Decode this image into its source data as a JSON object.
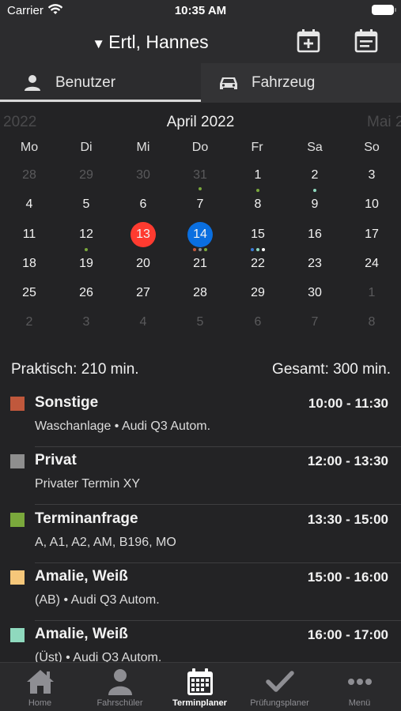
{
  "status_bar": {
    "carrier": "Carrier",
    "time": "10:35 AM"
  },
  "nav": {
    "title": "Ertl, Hannes",
    "dropdown_icon": "triangle-down-icon",
    "add_icon": "calendar-plus-icon",
    "list_icon": "calendar-list-icon"
  },
  "segment": {
    "user_label": "Benutzer",
    "vehicle_label": "Fahrzeug",
    "selected": "Benutzer"
  },
  "calendar": {
    "prev_label": "2022",
    "title": "April 2022",
    "next_label": "Mai 2",
    "weekdays": [
      "Mo",
      "Di",
      "Mi",
      "Do",
      "Fr",
      "Sa",
      "So"
    ],
    "weeks": [
      [
        "28",
        "29",
        "30",
        "31",
        "1",
        "2",
        "3"
      ],
      [
        "4",
        "5",
        "6",
        "7",
        "8",
        "9",
        "10"
      ],
      [
        "11",
        "12",
        "13",
        "14",
        "15",
        "16",
        "17"
      ],
      [
        "18",
        "19",
        "20",
        "21",
        "22",
        "23",
        "24"
      ],
      [
        "25",
        "26",
        "27",
        "28",
        "29",
        "30",
        "1"
      ],
      [
        "2",
        "3",
        "4",
        "5",
        "6",
        "7",
        "8"
      ]
    ],
    "today_color": "#ff3b30",
    "selected_color": "#0a6fe0"
  },
  "summary": {
    "practical": "Praktisch: 210 min.",
    "total": "Gesamt: 300 min."
  },
  "appointments": [
    {
      "title": "Sonstige",
      "time": "10:00 - 11:30",
      "subtitle": "Waschanlage • Audi Q3 Autom.",
      "color": "#c0583c"
    },
    {
      "title": "Privat",
      "time": "12:00 - 13:30",
      "subtitle": "Privater Termin XY",
      "color": "#8e8e8e"
    },
    {
      "title": "Terminanfrage",
      "time": "13:30 - 15:00",
      "subtitle": "A, A1, A2, AM, B196, MO",
      "color": "#7aa83c"
    },
    {
      "title": "Amalie, Weiß",
      "time": "15:00 - 16:00",
      "subtitle": "(AB) • Audi Q3 Autom.",
      "color": "#f5c77a"
    },
    {
      "title": "Amalie, Weiß",
      "time": "16:00 - 17:00",
      "subtitle": "(Üst) • Audi Q3 Autom.",
      "color": "#8fd9be"
    }
  ],
  "tabs": [
    {
      "label": "Home",
      "icon": "home-icon"
    },
    {
      "label": "Fahrschüler",
      "icon": "person-icon"
    },
    {
      "label": "Terminplaner",
      "icon": "calendar-icon"
    },
    {
      "label": "Prüfungsplaner",
      "icon": "checkmark-icon"
    },
    {
      "label": "Menü",
      "icon": "more-icon"
    }
  ],
  "active_tab": "Terminplaner"
}
